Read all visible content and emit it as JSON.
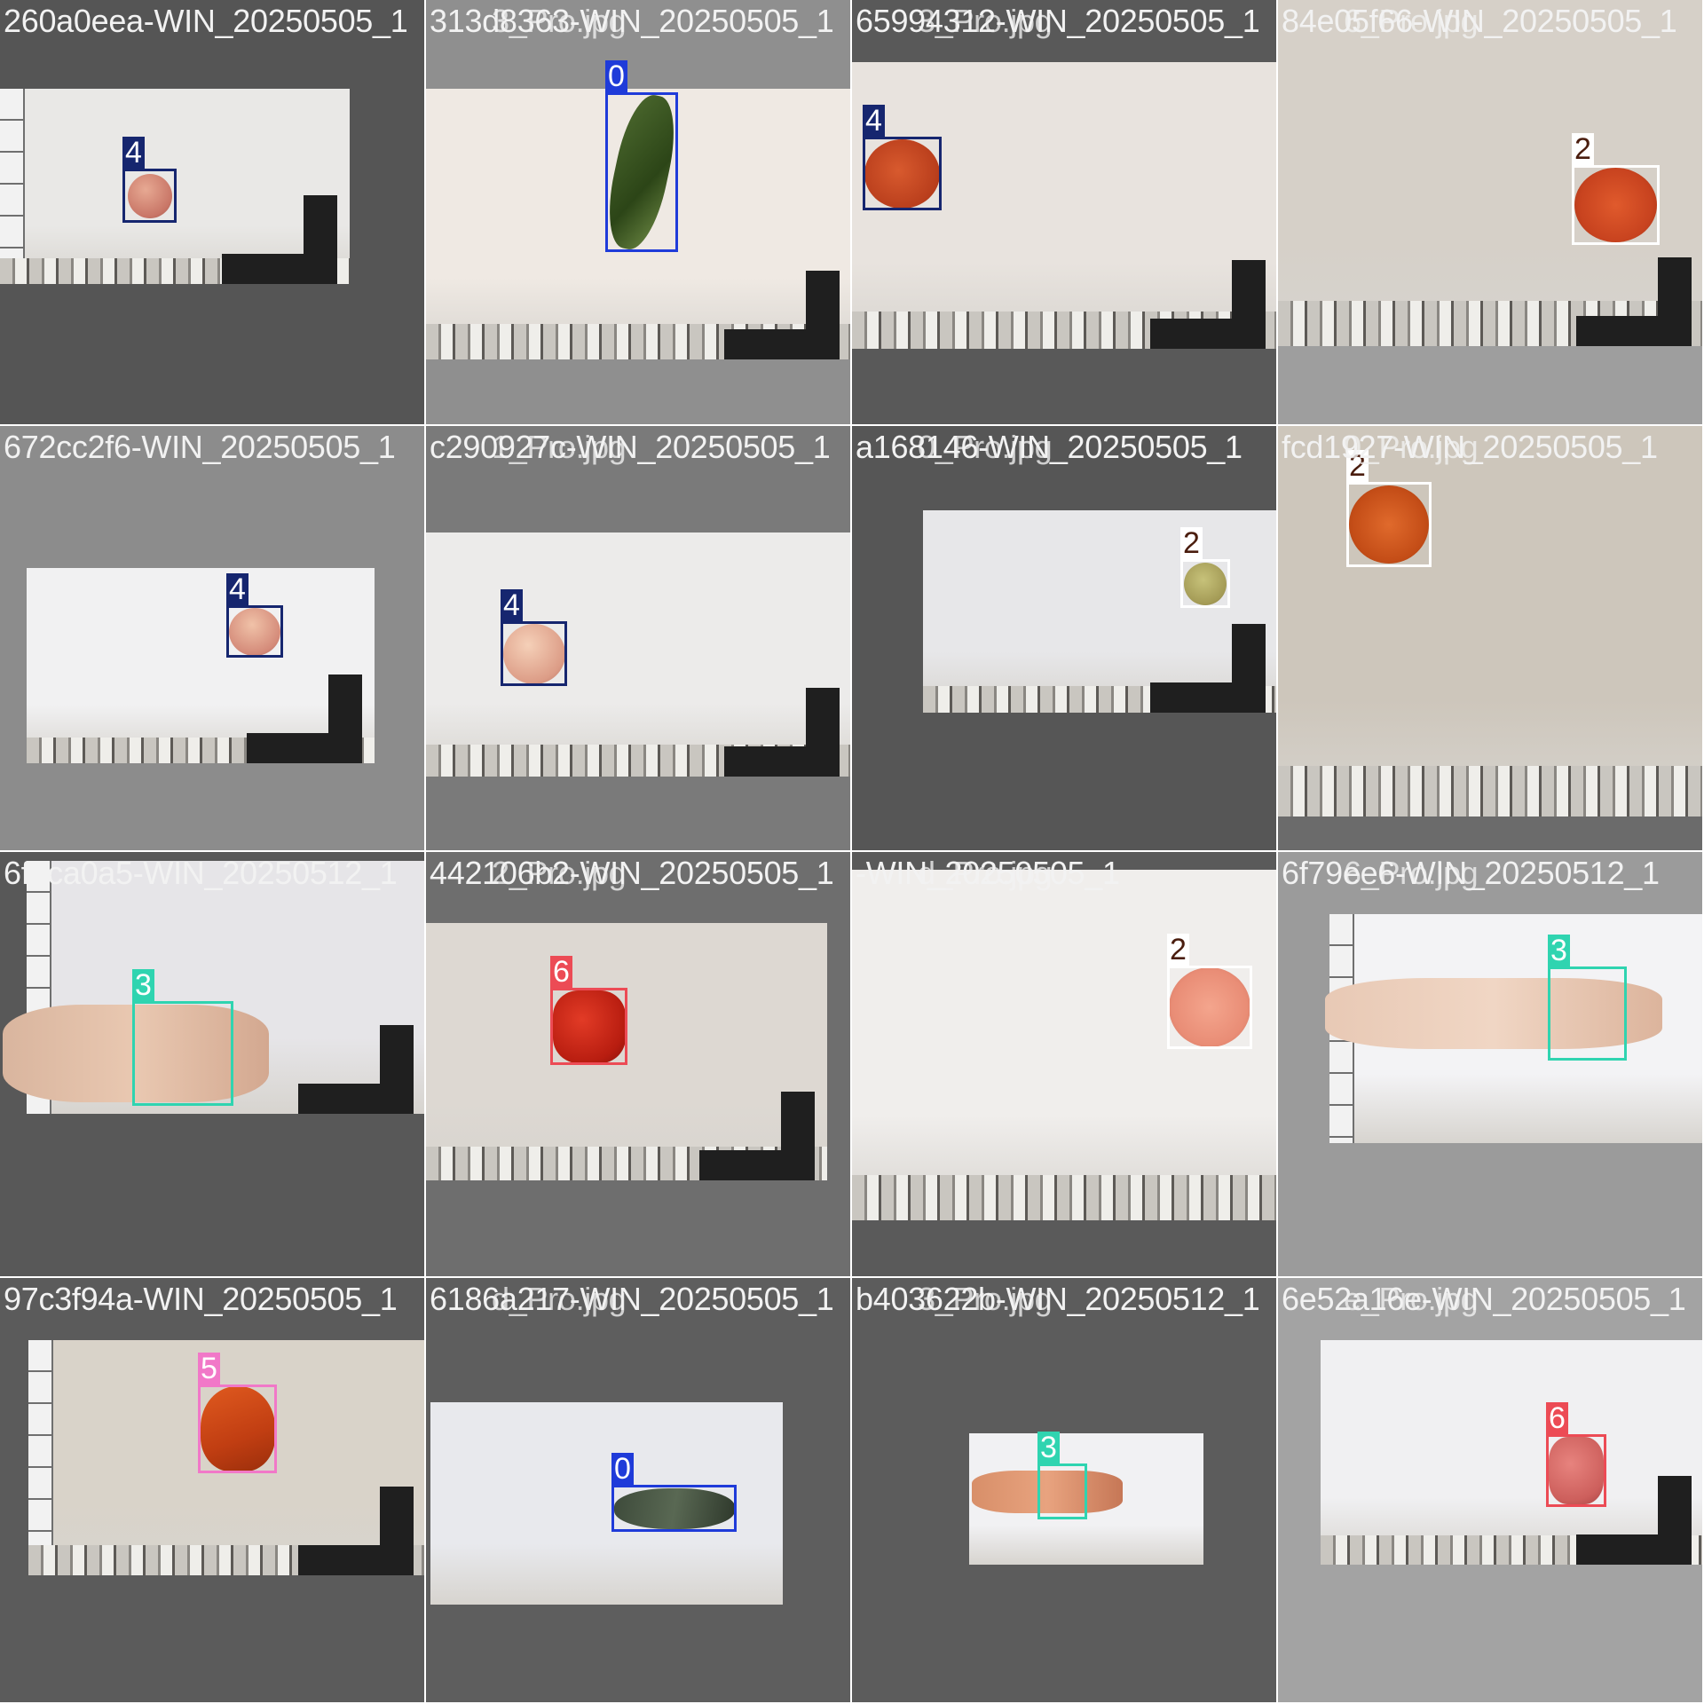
{
  "colors": {
    "0": {
      "box": "#1f3bd9",
      "label_bg": "#1f3bd9",
      "label_text": "#ffffff"
    },
    "2": {
      "box": "#ffffff",
      "label_bg": "#ffffff",
      "label_text": "#4a1d0e"
    },
    "3": {
      "box": "#2fd4b0",
      "label_bg": "#2fd4b0",
      "label_text": "#ffffff"
    },
    "4": {
      "box": "#16266f",
      "label_bg": "#16266f",
      "label_text": "#ffffff"
    },
    "5": {
      "box": "#f178c8",
      "label_bg": "#f178c8",
      "label_text": "#ffffff"
    },
    "6": {
      "box": "#ec4b55",
      "label_bg": "#ec4b55",
      "label_text": "#ffffff"
    }
  },
  "tiles": [
    {
      "filename": "260a0eea-WIN_20250505_1",
      "bg": "#555555",
      "detections": [
        {
          "class_label": "4"
        }
      ]
    },
    {
      "filename": "313d8363-WIN_20250505_1",
      "overlap_text": "3_Pro.jpg",
      "bg": "#8f8f8f",
      "detections": [
        {
          "class_label": "0"
        }
      ]
    },
    {
      "filename": "65994312-WIN_20250505_1",
      "overlap_text": "3_Pro.jpg",
      "bg": "#595959",
      "detections": [
        {
          "class_label": "4"
        }
      ]
    },
    {
      "filename": "84e05f66-WIN_20250505_1",
      "overlap_text": "6_Pro.jpg",
      "bg": "#9e9e9e",
      "detections": [
        {
          "class_label": "2"
        }
      ]
    },
    {
      "filename": "672cc2f6-WIN_20250505_1",
      "bg": "#8c8c8c",
      "detections": [
        {
          "class_label": "4"
        }
      ]
    },
    {
      "filename": "c290927c-WIN_20250505_1",
      "overlap_text": "1_Pro.jpg",
      "bg": "#7a7a7a",
      "detections": [
        {
          "class_label": "4"
        }
      ]
    },
    {
      "filename": "a168146-WIN_20250505_1",
      "overlap_text": "0_Pro.jpg",
      "bg": "#565656",
      "detections": [
        {
          "class_label": "2"
        }
      ]
    },
    {
      "filename": "fcd1927-WIN_20250505_1",
      "overlap_text": "0_Pro.jpg",
      "bg": "#6b6b6b",
      "detections": [
        {
          "class_label": "2"
        }
      ]
    },
    {
      "filename": "6f1ca0a5-WIN_20250512_1",
      "bg": "#585858",
      "detections": [
        {
          "class_label": "3"
        }
      ]
    },
    {
      "filename": "442106b2-WIN_20250505_1",
      "overlap_text": "2_Pro.jpg",
      "bg": "#6e6e6e",
      "detections": [
        {
          "class_label": "6"
        }
      ]
    },
    {
      "filename": "-WIN_20250505_1",
      "overlap_text": "d_Pro.jpg",
      "bg": "#5a5a5a",
      "detections": [
        {
          "class_label": "2"
        }
      ]
    },
    {
      "filename": "6f79ee6-WIN_20250512_1",
      "overlap_text": "6_Pro.jpg",
      "bg": "#9b9b9b",
      "detections": [
        {
          "class_label": "3"
        }
      ]
    },
    {
      "filename": "97c3f94a-WIN_20250505_1",
      "bg": "#5b5b5b",
      "detections": [
        {
          "class_label": "5"
        }
      ]
    },
    {
      "filename": "6186a217-WIN_20250505_1",
      "overlap_text": "d_Pro.jpg",
      "bg": "#5e5e5e",
      "detections": [
        {
          "class_label": "0"
        }
      ]
    },
    {
      "filename": "b403622b-WIN_20250512_1",
      "overlap_text": "3_Pro.jpg",
      "bg": "#5c5c5c",
      "detections": [
        {
          "class_label": "3"
        }
      ]
    },
    {
      "filename": "6e52a16e-WIN_20250505_1",
      "overlap_text": "e_Pro.jpg",
      "bg": "#a3a3a3",
      "detections": [
        {
          "class_label": "6"
        }
      ]
    }
  ]
}
